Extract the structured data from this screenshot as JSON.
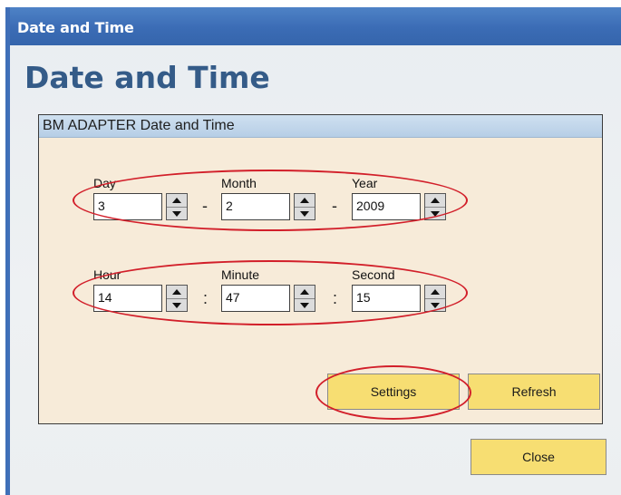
{
  "window": {
    "title": "Date and Time",
    "heading": "Date and Time"
  },
  "group": {
    "title": "BM ADAPTER Date and Time"
  },
  "date": {
    "day": {
      "label": "Day",
      "value": "3"
    },
    "month": {
      "label": "Month",
      "value": "2"
    },
    "year": {
      "label": "Year",
      "value": "2009"
    },
    "separator": "-"
  },
  "time": {
    "hour": {
      "label": "Hour",
      "value": "14"
    },
    "minute": {
      "label": "Minute",
      "value": "47"
    },
    "second": {
      "label": "Second",
      "value": "15"
    },
    "separator": ":"
  },
  "buttons": {
    "settings": "Settings",
    "refresh": "Refresh",
    "close": "Close"
  },
  "colors": {
    "titlebar": "#3b6cb5",
    "heading": "#345b88",
    "panel": "#f7ebd9",
    "button": "#f7de72",
    "highlight": "#d21f2a"
  }
}
